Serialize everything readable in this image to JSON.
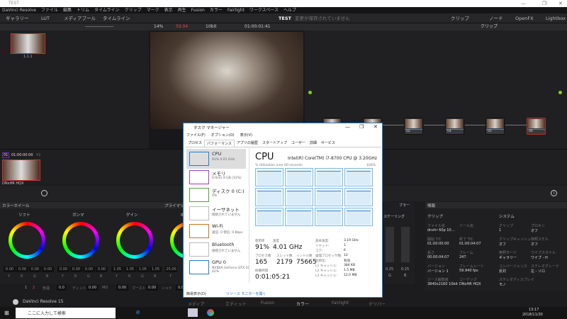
{
  "window": {
    "title": "TEST",
    "controls": [
      "—",
      "❐",
      "✕"
    ]
  },
  "menu": [
    "DaVinci Resolve",
    "ファイル",
    "編集",
    "トリム",
    "タイムライン",
    "クリップ",
    "マーク",
    "表示",
    "再生",
    "Fusion",
    "カラー",
    "Fairlight",
    "ワークスペース",
    "ヘルプ"
  ],
  "toolbar": {
    "gallery": "ギャラリー",
    "lut": "LUT",
    "media_pool": "メディアプール",
    "timeline": "タイムライン",
    "project": "TEST",
    "status": "変更が保存されていません",
    "clip": "クリップ",
    "node": "ノード",
    "openfx": "OpenFX",
    "lightbox": "Lightbox"
  },
  "viewer": {
    "zoom": "14%",
    "fps": "59.94",
    "bitdepth": "10bit",
    "timecode": "01:00:01:41",
    "node_mode": "クリップ"
  },
  "gallery": {
    "still_label": "1.1.1"
  },
  "nodes": [
    "03",
    "01",
    "02",
    "04",
    "05",
    "06"
  ],
  "timeline": {
    "clip_num": "01",
    "timecode": "01:00:00:00",
    "track": "V1",
    "codec": "DNxHR HQX"
  },
  "color": {
    "panel_title": "カラーホイール",
    "mode": "プライマリー",
    "wheels": [
      {
        "name": "リフト",
        "values": [
          "0.00",
          "0.00",
          "0.00",
          "0.00"
        ]
      },
      {
        "name": "ガンマ",
        "values": [
          "0.00",
          "0.00",
          "0.00",
          "0.00"
        ]
      },
      {
        "name": "ゲイン",
        "values": [
          "1.05",
          "1.05",
          "1.05",
          "1.05"
        ]
      },
      {
        "name": "オフセット",
        "values": [
          "25.00"
        ]
      }
    ],
    "channels": [
      "Y",
      "R",
      "G",
      "B"
    ],
    "bottom": [
      {
        "label": "色温",
        "value": "0.0"
      },
      {
        "label": "ティント",
        "value": "0.00"
      },
      {
        "label": "MD",
        "value": "0.00"
      },
      {
        "label": "ブースト",
        "value": "0.00"
      },
      {
        "label": "シャド",
        "value": "0.00"
      }
    ],
    "pages": [
      "1",
      "2"
    ]
  },
  "scaling": {
    "title": "スケーリング",
    "blur": "ブラー",
    "g": "0.25",
    "b": "0.25",
    "g_label": "G",
    "b_label": "B"
  },
  "info": {
    "title": "情報",
    "clip_h": "クリップ",
    "system_h": "システム",
    "fields": [
      {
        "l": "ファイル名",
        "v": "dnxhr 60p 10..."
      },
      {
        "l": "リール名",
        "v": ""
      },
      {
        "l": "開始 T/C",
        "v": "01:00:00:00"
      },
      {
        "l": "終了 T/C",
        "v": "01:00:04:07"
      },
      {
        "l": "長さ",
        "v": "00:00:04:07"
      },
      {
        "l": "フレーム",
        "v": "247"
      },
      {
        "l": "バージョン",
        "v": "バージョン 1"
      },
      {
        "l": "フレームレート",
        "v": "59.940 fps"
      },
      {
        "l": "ソース解像度",
        "v": "3840x2160 10bit"
      },
      {
        "l": "コーデック",
        "v": "DNxHR HQX"
      }
    ],
    "system": [
      {
        "l": "クリップ",
        "v": "1"
      },
      {
        "l": "プロキシ",
        "v": "オフ"
      },
      {
        "l": "クリップキャッシュ",
        "v": "オフ"
      },
      {
        "l": "参照スチル",
        "v": "オフ"
      },
      {
        "l": "参照モード",
        "v": "ギャラリー"
      },
      {
        "l": "ワイプスタイル",
        "v": "ワイプ - H"
      },
      {
        "l": "コンバージェンス",
        "v": "反対"
      },
      {
        "l": "ステレオグレード",
        "v": "左 - ソロ"
      },
      {
        "l": "ステレオディスプレイ",
        "v": "モノ"
      }
    ]
  },
  "app_name": "DaVinci Resolve 15",
  "pages": [
    "メディア",
    "エディット",
    "Fusion",
    "カラー",
    "Fairlight",
    "デリバー"
  ],
  "taskmgr": {
    "title": "タスク マネージャー",
    "menu": [
      "ファイル(F)",
      "オプション(O)",
      "表示(V)"
    ],
    "tabs": [
      "プロセス",
      "パフォーマンス",
      "アプリの履歴",
      "スタートアップ",
      "ユーザー",
      "詳細",
      "サービス"
    ],
    "items": [
      {
        "n": "CPU",
        "d": "91% 4.01 GHz",
        "c": "#1e7fd0"
      },
      {
        "n": "メモリ",
        "d": "9.9/31.9 GB (31%)",
        "c": "#a040c0"
      },
      {
        "n": "ディスク 0 (C:)",
        "d": "0%",
        "c": "#50a030"
      },
      {
        "n": "イーサネット",
        "d": "接続されていません",
        "c": "#bbb"
      },
      {
        "n": "Wi-Fi",
        "d": "送信: 0 受信: 0 Kbps",
        "c": "#d07020"
      },
      {
        "n": "Bluetooth",
        "d": "接続されていません",
        "c": "#bbb"
      },
      {
        "n": "GPU 0",
        "d": "NVIDIA GeForce GTX 10\n42%",
        "c": "#1e7fd0"
      }
    ],
    "heading": "CPU",
    "model": "Intel(R) Core(TM) i7-8700 CPU @ 3.20GHz",
    "util_label": "% Utilization over 60 seconds",
    "util_max": "100%",
    "usage_l": "使用率",
    "usage": "91%",
    "speed_l": "速度",
    "speed": "4.01 GHz",
    "proc_l": "プロセス数",
    "proc": "165",
    "thr_l": "スレッド数",
    "thr": "2179",
    "hnd_l": "ハンドル数",
    "hnd": "75665",
    "up_l": "稼働時間",
    "up": "0:01:05:21",
    "specs": [
      {
        "l": "基本速度:",
        "v": "3.19 GHz"
      },
      {
        "l": "ソケット:",
        "v": "1"
      },
      {
        "l": "コア:",
        "v": "6"
      },
      {
        "l": "論理プロセッサ数:",
        "v": "12"
      },
      {
        "l": "仮想化:",
        "v": "有効"
      },
      {
        "l": "L1 キャッシュ:",
        "v": "384 KB"
      },
      {
        "l": "L2 キャッシュ:",
        "v": "1.5 MB"
      },
      {
        "l": "L3 キャッシュ:",
        "v": "12.0 MB"
      }
    ],
    "fewer": "簡易表示(D)",
    "resmon": "リソース モニターを開く"
  },
  "taskbar": {
    "search": "ここに入力して検索",
    "time": "13:17",
    "date": "2018/11/30"
  }
}
